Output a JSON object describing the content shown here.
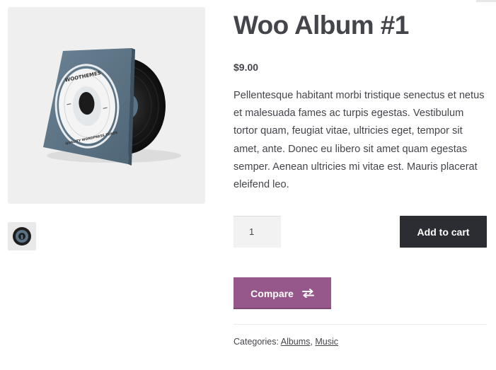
{
  "product": {
    "title": "Woo Album #1",
    "price": "$9.00",
    "description": "Pellentesque habitant morbi tristique senectus et netus et malesuada fames ac turpis egestas. Vestibulum tortor quam, feugiat vitae, ultricies eget, tempor sit amet, ante. Donec eu libero sit amet quam egestas semper. Aenean ultricies mi vitae est. Mauris placerat eleifend leo."
  },
  "image": {
    "icon": "album-cover-image",
    "cover_color": "#5a7386",
    "cover_text_top": "WOOTHEMES",
    "cover_text_bottom": "QUALITY WORDPRESS TUNES"
  },
  "cart": {
    "quantity": "1",
    "add_to_cart_label": "Add to cart"
  },
  "compare": {
    "label": "Compare",
    "icon": "swap-arrows-icon"
  },
  "meta": {
    "categories_label": "Categories:",
    "categories": [
      "Albums",
      "Music"
    ],
    "separator": ","
  },
  "colors": {
    "text": "#43454b",
    "add_to_cart_bg": "#2c2d33",
    "compare_bg": "#96588a",
    "image_bg": "#efefef"
  }
}
